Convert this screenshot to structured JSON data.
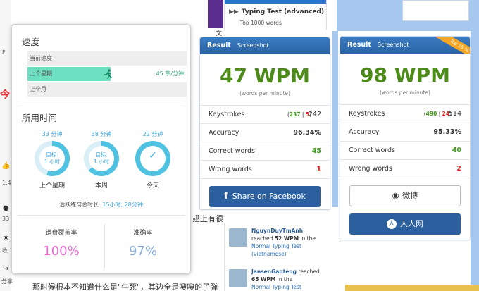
{
  "background": {
    "left_text_1": "F",
    "left_text_2": "今",
    "left_text_3": "1.4",
    "left_text_4": "33",
    "left_text_5": "收",
    "left_text_6": "分享",
    "mid_text": "文",
    "behind_text": "翅上有很",
    "bottom_text": "那时候根本不知道什么是\"牛死\"，其边全是嗖嗖的子弹"
  },
  "typing_test": {
    "title": "Typing Test (advanced)",
    "subtitle": "Top 1000 words"
  },
  "stats_popup": {
    "speed_title": "速度",
    "speed_rows": [
      {
        "label": "当前速度",
        "value": ""
      },
      {
        "label": "上个星期",
        "value": "45 字/分钟"
      },
      {
        "label": "上个月",
        "value": ""
      }
    ],
    "last_week_fraction": 0.52,
    "time_title": "所用时间",
    "rings": [
      {
        "top": "33 分钟",
        "goal": "目标:",
        "goal_time": "1 小时",
        "bottom": "上个星期",
        "fraction": 0.55
      },
      {
        "top": "38 分钟",
        "goal": "目标:",
        "goal_time": "1 小时",
        "bottom": "本周",
        "fraction": 0.63
      },
      {
        "top": "22 分钟",
        "goal": "✓",
        "goal_time": "",
        "bottom": "今天",
        "fraction": 1.0
      }
    ],
    "active_total_label": "活跃练习总时长:",
    "active_total_value": "15小时, 28分钟",
    "coverage_label": "键盘覆盖率",
    "coverage_value": "100%",
    "accuracy_label": "准确率",
    "accuracy_value": "97%",
    "colors": {
      "coverage": "#e86ad6",
      "accuracy": "#8aaee0",
      "ring": "#4ec2e0",
      "fill": "#6ee0c2"
    }
  },
  "result_left": {
    "header": "Result",
    "header_tab": "Screenshot",
    "wpm": "47 WPM",
    "wpm_sub": "(words per minute)",
    "keystrokes_label": "Keystrokes",
    "keystrokes_correct": "237",
    "keystrokes_wrong": "5",
    "keystrokes_total": "242",
    "accuracy_label": "Accuracy",
    "accuracy_value": "96.34%",
    "correct_label": "Correct words",
    "correct_value": "45",
    "wrong_label": "Wrong words",
    "wrong_value": "1",
    "share_button": "Share on Facebook",
    "fb_letter": "f"
  },
  "result_right": {
    "header": "Result",
    "header_tab": "Screenshot",
    "ribbon": "Top 15 %",
    "wpm": "98 WPM",
    "wpm_sub": "(words per minute)",
    "keystrokes_label": "Keystrokes",
    "keystrokes_correct": "490",
    "keystrokes_wrong": "24",
    "keystrokes_total": "514",
    "accuracy_label": "Accuracy",
    "accuracy_value": "95.33%",
    "correct_label": "Correct words",
    "correct_value": "40",
    "wrong_label": "Wrong words",
    "wrong_value": "2",
    "weibo_button": "微博",
    "renren_button": "人人网"
  },
  "feed": [
    {
      "name": "NguynDuyTmAnh",
      "reached": "reached",
      "wpm": "52 WPM",
      "in": "in the",
      "test": "Normal Typing Test",
      "lang": "(vietnamese)"
    },
    {
      "name": "JansenGanteng",
      "reached": "reached",
      "wpm": "65 WPM",
      "in": "in the",
      "test": "Normal Typing Test (indonesian)",
      "lang": ""
    }
  ]
}
